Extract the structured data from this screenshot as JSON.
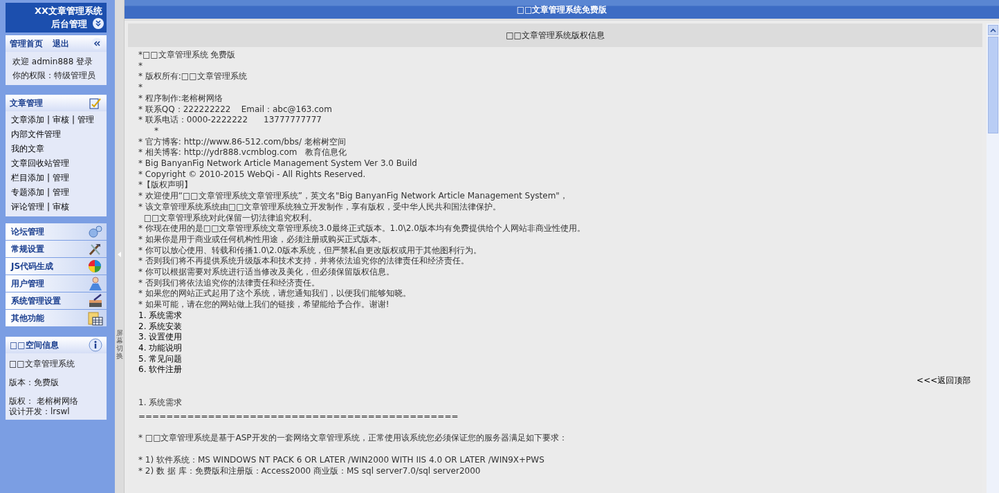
{
  "sidebar": {
    "logo": {
      "title": "XX文章管理系统",
      "subtitle": "后台管理"
    },
    "user_panel": {
      "links": [
        "管理首页",
        "退出"
      ],
      "lines": [
        "欢迎 admin888 登录",
        "你的权限：特级管理员"
      ]
    },
    "article_menu": {
      "title": "文章管理",
      "separator": "|",
      "items": [
        {
          "links": [
            "文章添加",
            "审核",
            "管理"
          ]
        },
        {
          "links": [
            "内部文件管理"
          ]
        },
        {
          "links": [
            "我的文章"
          ]
        },
        {
          "links": [
            "文章回收站管理"
          ]
        },
        {
          "links": [
            "栏目添加",
            "管理"
          ]
        },
        {
          "links": [
            "专题添加",
            "管理"
          ]
        },
        {
          "links": [
            "评论管理",
            "审核"
          ]
        }
      ]
    },
    "sections": [
      {
        "label": "论坛管理"
      },
      {
        "label": "常规设置"
      },
      {
        "label": "JS代码生成"
      },
      {
        "label": "用户管理"
      },
      {
        "label": "系统管理设置"
      },
      {
        "label": "其他功能"
      }
    ],
    "info_panel": {
      "title": "□□空间信息",
      "paragraphs": [
        [
          "□□文章管理系统"
        ],
        [
          "版本：免费版"
        ],
        [
          "版权： 老榕树网络",
          "设计开发：lrswl"
        ]
      ]
    }
  },
  "splitter": {
    "label": "屏幕切换"
  },
  "main": {
    "title": "□□文章管理系统免费版",
    "panel_title": "□□文章管理系统版权信息",
    "lines": [
      {
        "kind": "text",
        "text": "*□□文章管理系统 免费版"
      },
      {
        "kind": "text",
        "text": "*"
      },
      {
        "kind": "text",
        "text": "* 版权所有:□□文章管理系统"
      },
      {
        "kind": "text",
        "text": "*"
      },
      {
        "kind": "text",
        "text": "* 程序制作:老榕树网络"
      },
      {
        "kind": "text",
        "text": "* 联系QQ：222222222    Email：abc@163.com"
      },
      {
        "kind": "text",
        "text": "* 联系电话：0000-2222222      13777777777"
      },
      {
        "kind": "text",
        "text": "      *"
      },
      {
        "kind": "text",
        "text": "* 官方博客: http://www.86-512.com/bbs/ 老榕树空间"
      },
      {
        "kind": "text",
        "text": "* 相关博客: http://ydr888.vcmblog.com   教育信息化"
      },
      {
        "kind": "text",
        "text": "* Big BanyanFig Network Article Management System Ver 3.0 Build"
      },
      {
        "kind": "text",
        "text": "* Copyright © 2010-2015 WebQi - All Rights Reserved."
      },
      {
        "kind": "text",
        "text": "*【版权声明】"
      },
      {
        "kind": "text",
        "text": "* 欢迎使用“□□文章管理系统文章管理系统”，英文名\"Big BanyanFig Network Article Management System\"，"
      },
      {
        "kind": "text",
        "text": "* 该文章管理系统系统由□□文章管理系统独立开发制作，享有版权，受中华人民共和国法律保护。"
      },
      {
        "kind": "text",
        "text": "  □□文章管理系统对此保留一切法律追究权利。"
      },
      {
        "kind": "text",
        "text": "* 你现在使用的是□□文章管理系统文章管理系统3.0最终正式版本。1.0\\2.0版本均有免费提供给个人网站非商业性使用。"
      },
      {
        "kind": "text",
        "text": "* 如果你是用于商业或任何机构性用途，必须注册或购买正式版本。"
      },
      {
        "kind": "text",
        "text": "* 你可以放心使用、转载和传播1.0\\2.0版本系统，但严禁私自更改版权或用于其他图利行为。"
      },
      {
        "kind": "text",
        "text": "* 否则我们将不再提供系统升级版本和技术支持，并将依法追究你的法律责任和经济责任。"
      },
      {
        "kind": "text",
        "text": "* 你可以根据需要对系统进行适当修改及美化，但必须保留版权信息。"
      },
      {
        "kind": "text",
        "text": "* 否则我们将依法追究你的法律责任和经济责任。"
      },
      {
        "kind": "text",
        "text": "* 如果您的网站正式起用了这个系统，请您通知我们，以便我们能够知晓。"
      },
      {
        "kind": "text",
        "text": "* 如果可能，请在您的网站做上我们的链接，希望能给予合作。谢谢!"
      },
      {
        "kind": "toc",
        "text": "1. 系统需求"
      },
      {
        "kind": "toc",
        "text": "2. 系统安装"
      },
      {
        "kind": "toc",
        "text": "3. 设置使用"
      },
      {
        "kind": "toc",
        "text": "4. 功能说明"
      },
      {
        "kind": "toc",
        "text": "5. 常见问题"
      },
      {
        "kind": "toc",
        "text": "6. 软件注册"
      },
      {
        "kind": "back",
        "text": "<<<返回顶部"
      },
      {
        "kind": "blank"
      },
      {
        "kind": "text",
        "text": "1. 系统需求"
      },
      {
        "kind": "rule",
        "text": "=============================================="
      },
      {
        "kind": "blank"
      },
      {
        "kind": "text",
        "text": "* □□文章管理系统是基于ASP开发的一套网络文章管理系统，正常使用该系统您必须保证您的服务器满足如下要求："
      },
      {
        "kind": "blank"
      },
      {
        "kind": "text",
        "text": "* 1) 软件系统：MS WINDOWS NT PACK 6 OR LATER /WIN2000 WITH IIS 4.0 OR LATER /WIN9X+PWS"
      },
      {
        "kind": "text",
        "text": "* 2) 数 据 库：免费版和注册版：Access2000 商业版：MS sql server7.0/sql server2000"
      }
    ]
  }
}
